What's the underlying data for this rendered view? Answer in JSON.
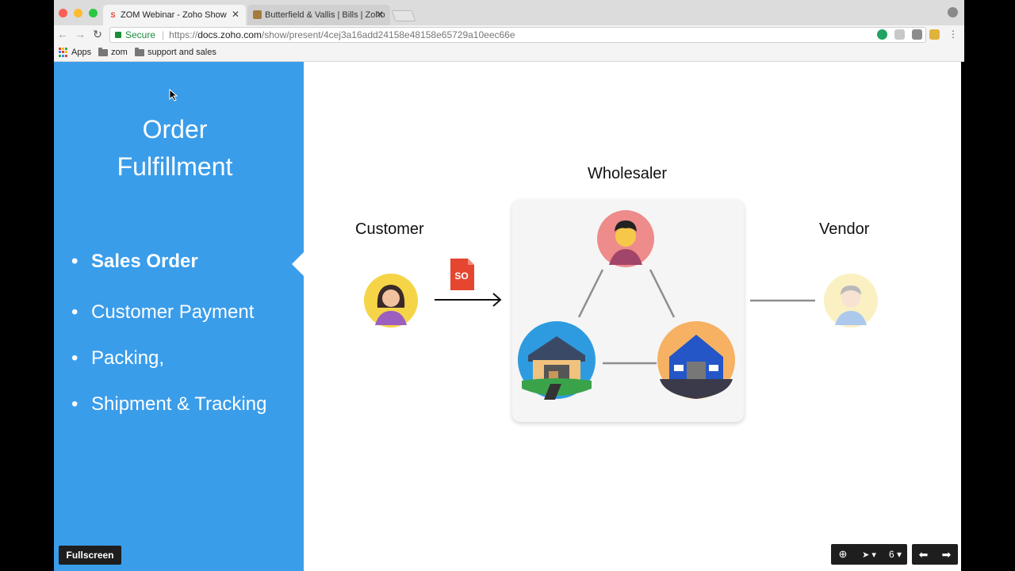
{
  "browser": {
    "tabs": [
      {
        "label": "ZOM Webinar - Zoho Show",
        "active": true
      },
      {
        "label": "Butterfield & Vallis | Bills | Zoho",
        "active": false
      }
    ],
    "address": {
      "secure_label": "Secure",
      "scheme": "https://",
      "host": "docs.zoho.com",
      "path": "/show/present/4cej3a16add24158e48158e65729a10eec66e"
    },
    "bookmarks": [
      {
        "label": "Apps",
        "icon": "apps-grid-icon"
      },
      {
        "label": "zom",
        "icon": "folder-icon"
      },
      {
        "label": "support and sales",
        "icon": "folder-icon"
      }
    ]
  },
  "slide": {
    "title_line1": "Order",
    "title_line2": "Fulfillment",
    "bullets": [
      "Sales Order",
      "Customer Payment",
      "Packing,",
      "Shipment & Tracking"
    ],
    "labels": {
      "customer": "Customer",
      "wholesaler": "Wholesaler",
      "vendor": "Vendor"
    },
    "document_badge": "SO"
  },
  "controls": {
    "fullscreen_label": "Fullscreen",
    "page_number": "6"
  },
  "colors": {
    "panel_blue": "#3a9dea",
    "badge_red": "#e5462f"
  }
}
